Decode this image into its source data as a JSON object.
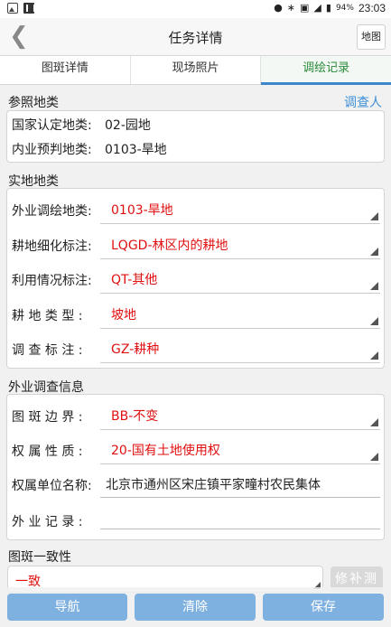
{
  "status_bar": {
    "battery": "94%",
    "time": "23:03"
  },
  "header": {
    "back_icon": "chevron-left-icon",
    "title": "任务详情",
    "map_button": "地图"
  },
  "tabs": [
    {
      "label": "图斑详情",
      "active": false
    },
    {
      "label": "现场照片",
      "active": false
    },
    {
      "label": "调绘记录",
      "active": true
    }
  ],
  "reference": {
    "section_title": "参照地类",
    "investigator_link": "调查人",
    "rows": [
      {
        "label": "国家认定地类:",
        "value": "02-园地"
      },
      {
        "label": "内业预判地类:",
        "value": "0103-旱地"
      }
    ]
  },
  "actual": {
    "section_title": "实地地类",
    "rows": [
      {
        "label": "外业调绘地类:",
        "value": "0103-旱地"
      },
      {
        "label": "耕地细化标注:",
        "value": "LQGD-林区内的耕地"
      },
      {
        "label": "利用情况标注:",
        "value": "QT-其他"
      },
      {
        "label": "耕 地 类 型 :",
        "value": "坡地"
      },
      {
        "label": "调 查 标 注 :",
        "value": "GZ-耕种"
      }
    ]
  },
  "field_survey": {
    "section_title": "外业调查信息",
    "boundary": {
      "label": "图 斑 边 界 :",
      "value": "BB-不变"
    },
    "ownership": {
      "label": "权 属 性 质 :",
      "value": "20-国有土地使用权"
    },
    "owner_unit": {
      "label": "权属单位名称:",
      "value": "北京市通州区宋庄镇平家疃村农民集体"
    },
    "field_record": {
      "label": "外 业 记 录 :",
      "value": ""
    }
  },
  "consistency": {
    "section_title": "图斑一致性",
    "value": "一致",
    "fix_button": "修补测"
  },
  "bottom_buttons": {
    "navigate": "导航",
    "clear": "清除",
    "save": "保存"
  },
  "colors": {
    "accent_blue": "#3d86c9",
    "button_blue": "#7fb1e0",
    "value_red": "#e01010",
    "active_tab_green": "#2a8a3a"
  }
}
